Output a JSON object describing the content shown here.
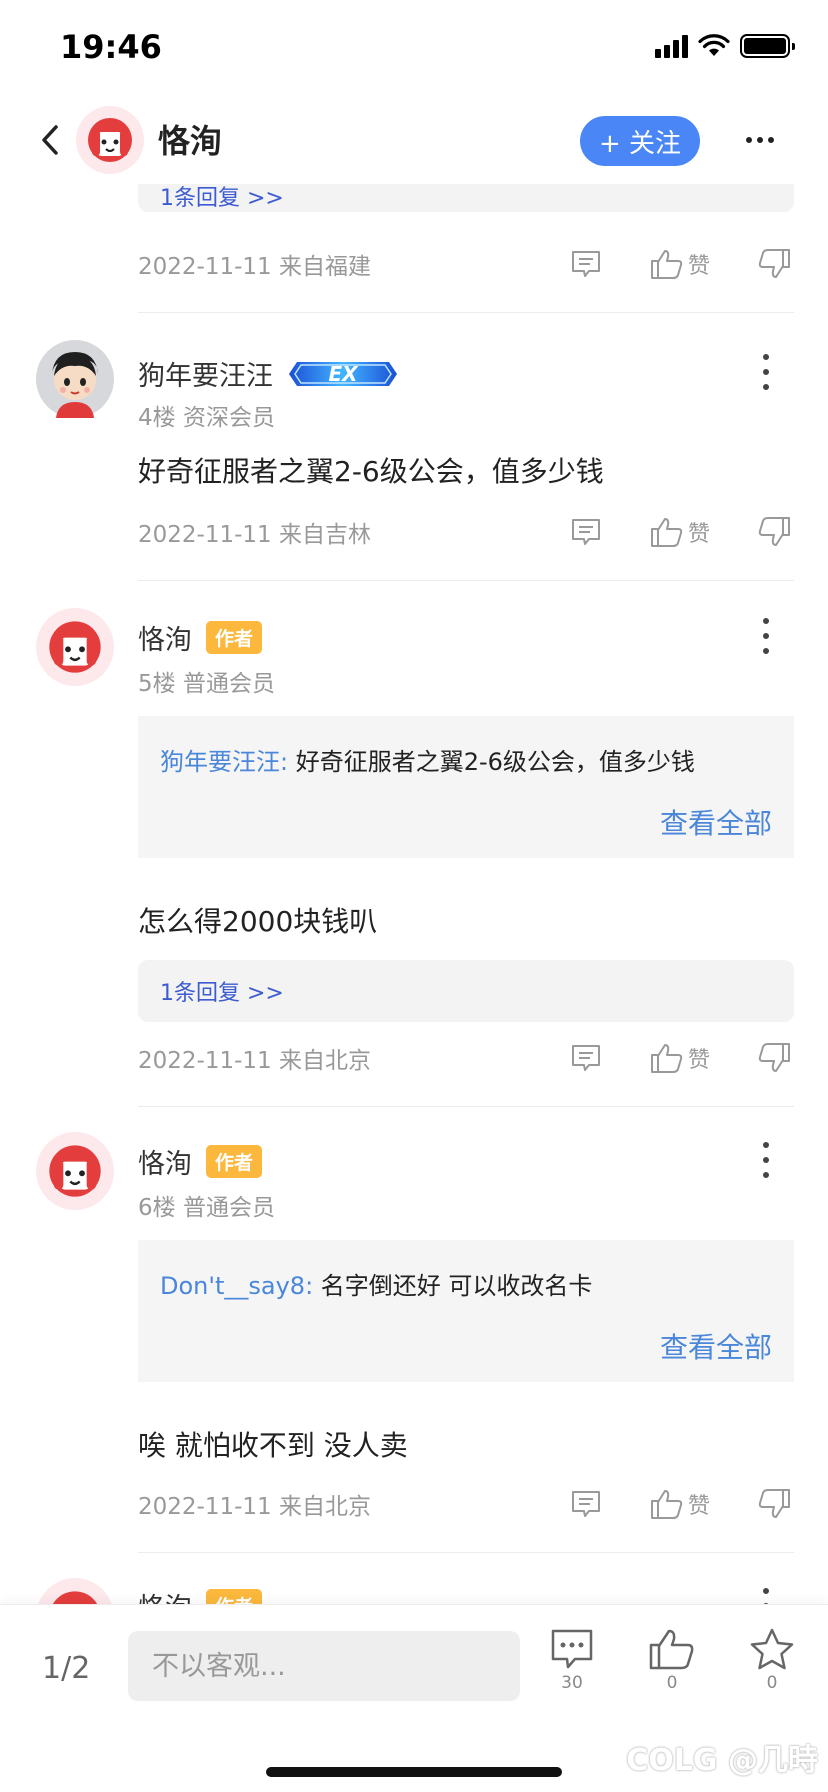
{
  "status_bar": {
    "time": "19:46"
  },
  "header": {
    "title": "恪洵",
    "follow_label": "+ 关注"
  },
  "posts": [
    {
      "reply_summary": "1条回复 >>",
      "meta": "2022-11-11 来自福建",
      "like_label": "赞"
    },
    {
      "name": "狗年要汪汪",
      "badge": "EX",
      "floor_info": "4楼 资深会员",
      "text": "好奇征服者之翼2-6级公会，值多少钱",
      "meta": "2022-11-11 来自吉林",
      "like_label": "赞"
    },
    {
      "name": "恪洵",
      "author_tag": "作者",
      "floor_info": "5楼 普通会员",
      "quote_user": "狗年要汪汪:",
      "quote_text": "好奇征服者之翼2-6级公会，值多少钱",
      "quote_more": "查看全部",
      "text": "怎么得2000块钱叭",
      "reply_summary": "1条回复 >>",
      "meta": "2022-11-11 来自北京",
      "like_label": "赞"
    },
    {
      "name": "恪洵",
      "author_tag": "作者",
      "floor_info": "6楼 普通会员",
      "quote_user": "Don't__say8:",
      "quote_text": "名字倒还好  可以收改名卡",
      "quote_more": "查看全部",
      "text": "唉 就怕收不到 没人卖",
      "meta": "2022-11-11 来自北京",
      "like_label": "赞"
    },
    {
      "name": "恪洵",
      "author_tag": "作者"
    }
  ],
  "bottom_bar": {
    "page": "1/2",
    "input_placeholder": "不以客观...",
    "comments_count": "30",
    "likes_count": "0",
    "favorites_count": "0"
  },
  "watermark": "COLG @几時",
  "colors": {
    "accent": "#4a86f5",
    "link": "#4a86d9",
    "reply_link": "#3d5bd1",
    "author_tag": "#fbb83c"
  },
  "icons": [
    "back-icon",
    "more-icon",
    "comment-icon",
    "thumb-up-icon",
    "thumb-down-icon",
    "star-icon",
    "wifi-icon",
    "signal-icon",
    "battery-icon"
  ]
}
